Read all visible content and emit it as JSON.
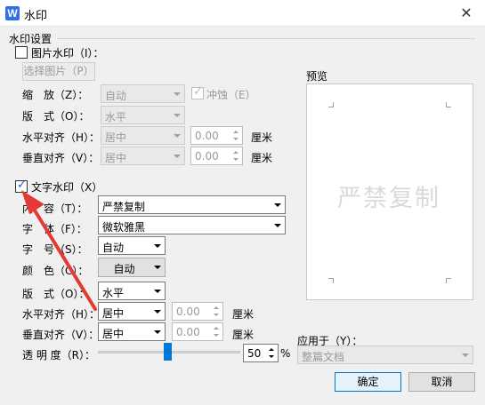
{
  "window": {
    "title": "水印",
    "close_glyph": "✕",
    "app_icon_glyph": "W"
  },
  "section_title": "水印设置",
  "image_watermark": {
    "checkbox_label": "图片水印（I）：",
    "checked": false,
    "select_image_button": "选择图片（P）",
    "scale_label": "缩　放（Z）：",
    "scale_value": "自动",
    "washout_label": "冲蚀（E）",
    "washout_checked": true,
    "layout_label": "版　式（O）：",
    "layout_value": "水平",
    "h_align_label": "水平对齐（H）：",
    "h_align_value": "居中",
    "h_offset_value": "0.00",
    "v_align_label": "垂直对齐（V）：",
    "v_align_value": "居中",
    "v_offset_value": "0.00",
    "unit": "厘米"
  },
  "text_watermark": {
    "checkbox_label": "文字水印（X）",
    "checked": true,
    "content_label": "容（T）：",
    "content_value": "严禁复制",
    "font_label": "体（F）：",
    "font_value": "微软雅黑",
    "size_label": "号（S）：",
    "size_value": "自动",
    "color_label": "色（C）：",
    "color_value": "自动",
    "layout_label": "版　式（O）：",
    "layout_value": "水平",
    "h_align_label": "水平对齐（H）：",
    "h_align_value": "居中",
    "h_offset_value": "0.00",
    "v_align_label": "垂直对齐（V）：",
    "v_align_value": "居中",
    "v_offset_value": "0.00",
    "unit": "厘米",
    "transparency_label": "透 明 度（R）：",
    "transparency_value": "50",
    "transparency_fraction": 0.5,
    "percent": "%"
  },
  "preview": {
    "label": "预览",
    "watermark_text": "严禁复制"
  },
  "apply_to": {
    "label": "应用于（Y）：",
    "value": "整篇文档"
  },
  "buttons": {
    "ok": "确定",
    "cancel": "取消"
  },
  "annotation_color": "#e53935",
  "accent_color": "#0078d7"
}
